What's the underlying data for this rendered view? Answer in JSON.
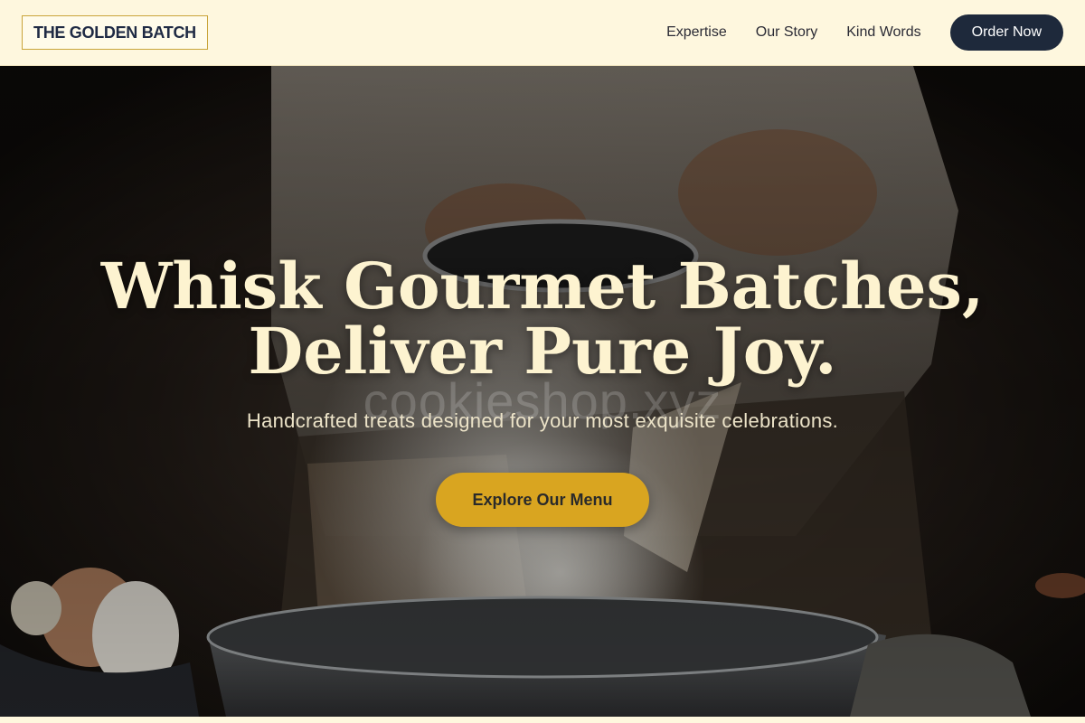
{
  "brand": {
    "logo_text": "THE GOLDEN BATCH"
  },
  "nav": {
    "links": [
      {
        "label": "Expertise"
      },
      {
        "label": "Our Story"
      },
      {
        "label": "Kind Words"
      }
    ],
    "cta_label": "Order Now"
  },
  "hero": {
    "headline_line1": "Whisk Gourmet Batches,",
    "headline_line2": "Deliver Pure Joy.",
    "watermark": "cookieshop.xyz",
    "subtitle": "Handcrafted treats designed for your most exquisite celebrations.",
    "cta_label": "Explore Our Menu",
    "image_description_icon": "baker-sifting-flour-photo"
  },
  "colors": {
    "accent": "#d9a520",
    "nav_bg": "#fef7de",
    "dark_button": "#1e293b",
    "headline": "#fdf3d0"
  }
}
